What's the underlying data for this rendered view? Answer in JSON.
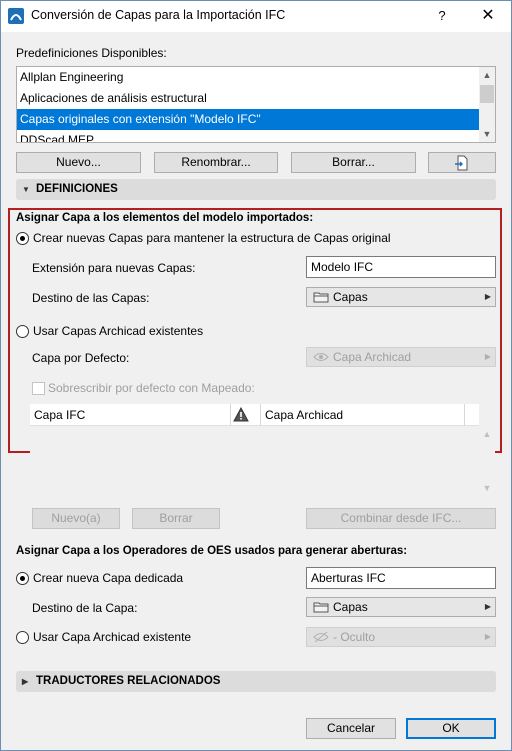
{
  "window": {
    "title": "Conversión de Capas para la Importación IFC",
    "help_label": "?",
    "close_label": "✕"
  },
  "presets": {
    "label": "Predefiniciones Disponibles:",
    "items": [
      "Allplan Engineering",
      "Aplicaciones de análisis estructural",
      "Capas originales con extensión \"Modelo IFC\"",
      "DDScad MEP"
    ],
    "selected_index": 2,
    "buttons": {
      "new": "Nuevo...",
      "rename": "Renombrar...",
      "delete": "Borrar..."
    }
  },
  "definitions": {
    "header": "DEFINICIONES",
    "assign_heading": "Asignar Capa a los elementos del modelo importados:",
    "create_new_radio": "Crear nuevas Capas para mantener la estructura de Capas original",
    "extension_label": "Extensión para nuevas Capas:",
    "extension_value": "Modelo IFC",
    "target_label": "Destino de las Capas:",
    "target_value": "Capas",
    "use_existing_radio": "Usar Capas Archicad existentes",
    "default_layer_label": "Capa por Defecto:",
    "default_layer_value": "Capa Archicad",
    "overwrite_checkbox": "Sobrescribir por defecto con Mapeado:",
    "table": {
      "columns": [
        "Capa IFC",
        "Capa Archicad"
      ]
    },
    "table_buttons": {
      "new": "Nuevo(a)",
      "delete": "Borrar",
      "combine": "Combinar desde IFC..."
    }
  },
  "openings": {
    "heading": "Asignar Capa a los Operadores de OES usados para generar aberturas:",
    "create_radio": "Crear nueva Capa dedicada",
    "create_value": "Aberturas IFC",
    "target_label": "Destino de la Capa:",
    "target_value": "Capas",
    "use_existing_radio": "Usar Capa Archicad existente",
    "existing_value": "- Oculto"
  },
  "translators": {
    "header": "TRADUCTORES RELACIONADOS"
  },
  "footer": {
    "cancel": "Cancelar",
    "ok": "OK"
  },
  "colors": {
    "selection": "#0078d7",
    "highlight_frame": "#b21f1f",
    "section_bar": "#dcdcdc"
  }
}
